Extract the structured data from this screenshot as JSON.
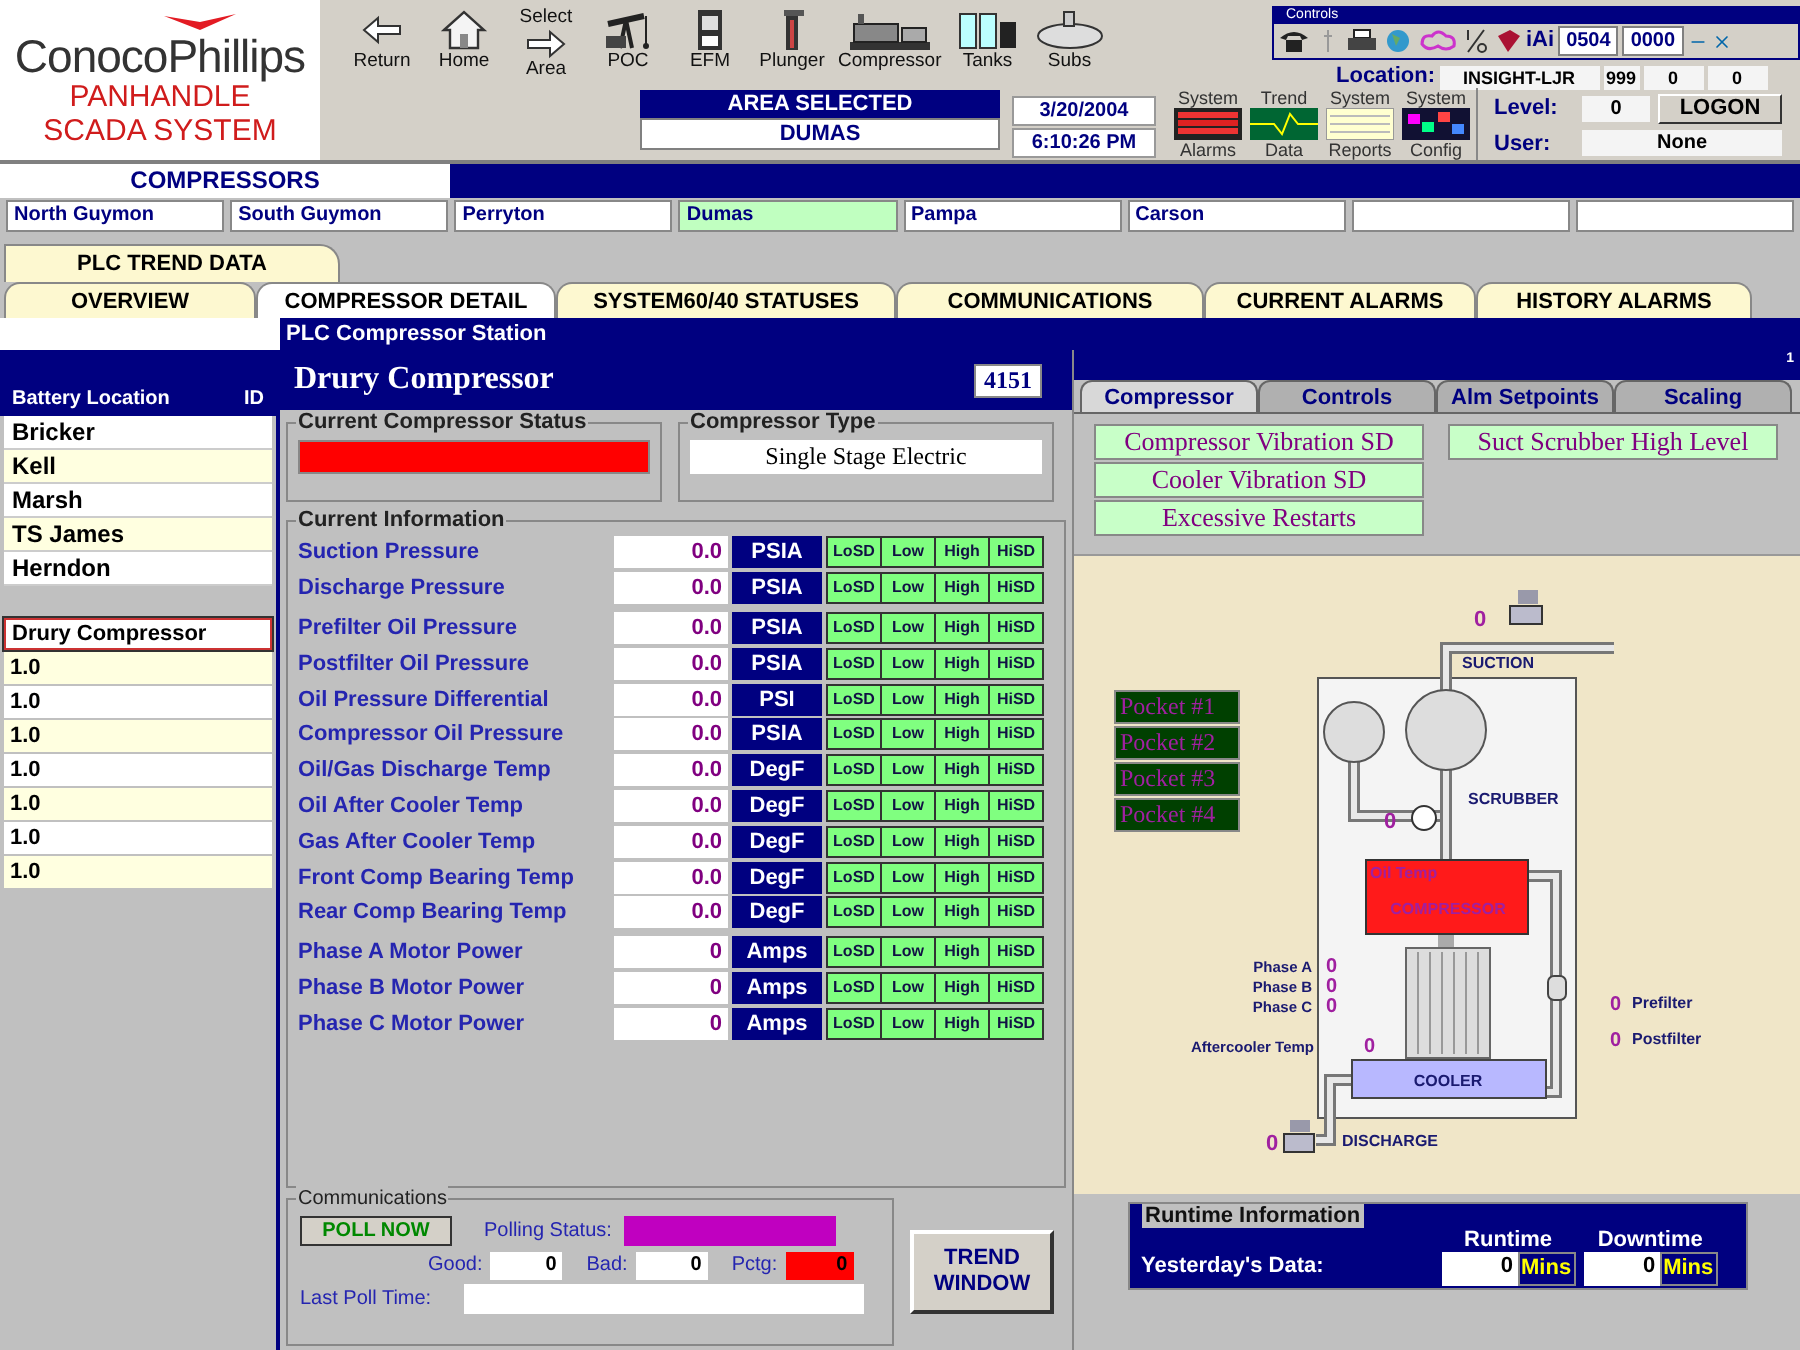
{
  "logo": {
    "company": "ConocoPhillips",
    "subtitle": [
      "PANHANDLE",
      "SCADA SYSTEM"
    ]
  },
  "toolbar": [
    {
      "kind": "return",
      "label": "Return"
    },
    {
      "kind": "home",
      "label": "Home"
    },
    {
      "kind": "select",
      "top_label": "Select",
      "label": "Area"
    },
    {
      "kind": "poc",
      "label": "POC"
    },
    {
      "kind": "efm",
      "label": "EFM"
    },
    {
      "kind": "plunger",
      "label": "Plunger"
    },
    {
      "kind": "compressor",
      "label": "Compressor"
    },
    {
      "kind": "tanks",
      "label": "Tanks"
    },
    {
      "kind": "subs",
      "label": "Subs"
    }
  ],
  "controls": {
    "title": "Controls",
    "brand": "iAi",
    "codes": [
      "0504",
      "0000"
    ]
  },
  "location": {
    "label": "Location:",
    "value": "INSIGHT-LJR",
    "fields": [
      "999",
      "0",
      "0"
    ]
  },
  "area": {
    "title": "AREA SELECTED",
    "value": "DUMAS"
  },
  "date": "3/20/2004",
  "time": "6:10:26 PM",
  "system_buttons": [
    {
      "kind": "alarms",
      "top": "System",
      "bottom": "Alarms"
    },
    {
      "kind": "trend",
      "top": "Trend",
      "bottom": "Data"
    },
    {
      "kind": "reports",
      "top": "System",
      "bottom": "Reports"
    },
    {
      "kind": "config",
      "top": "System",
      "bottom": "Config"
    }
  ],
  "level": {
    "label": "Level:",
    "value": "0"
  },
  "logon": "LOGON",
  "user": {
    "label": "User:",
    "value": "None"
  },
  "section_title": "COMPRESSORS",
  "areas": [
    {
      "label": "North Guymon",
      "selected": false
    },
    {
      "label": "South Guymon",
      "selected": false
    },
    {
      "label": "Perryton",
      "selected": false
    },
    {
      "label": "Dumas",
      "selected": true
    },
    {
      "label": "Pampa",
      "selected": false
    },
    {
      "label": "Carson",
      "selected": false
    }
  ],
  "tabs_top": [
    {
      "label": "PLC TREND DATA",
      "selected": false
    }
  ],
  "tabs": [
    {
      "label": "OVERVIEW",
      "selected": false
    },
    {
      "label": "COMPRESSOR DETAIL",
      "selected": true
    },
    {
      "label": "SYSTEM60/40 STATUSES",
      "selected": false
    },
    {
      "label": "COMMUNICATIONS",
      "selected": false
    },
    {
      "label": "CURRENT ALARMS",
      "selected": false
    },
    {
      "label": "HISTORY ALARMS",
      "selected": false
    }
  ],
  "station_title": "PLC Compressor Station",
  "battery_list": {
    "header": "Battery Location",
    "id_header": "ID",
    "items": [
      {
        "label": "Bricker",
        "selected": false
      },
      {
        "label": "Kell",
        "selected": false
      },
      {
        "label": "Marsh",
        "selected": false
      },
      {
        "label": "TS James",
        "selected": false
      },
      {
        "label": "Herndon",
        "selected": false
      }
    ]
  },
  "compressor_list": [
    {
      "label": "Drury Compressor",
      "selected": true
    },
    {
      "label": "1.0",
      "selected": false
    },
    {
      "label": "1.0",
      "selected": false
    },
    {
      "label": "1.0",
      "selected": false
    },
    {
      "label": "1.0",
      "selected": false
    },
    {
      "label": "1.0",
      "selected": false
    },
    {
      "label": "1.0",
      "selected": false
    },
    {
      "label": "1.0",
      "selected": false
    }
  ],
  "detail": {
    "title": "Drury Compressor",
    "id": "4151",
    "status_label": "Current Compressor Status",
    "type_label": "Compressor Type",
    "type": "Single Stage Electric",
    "info_label": "Current Information",
    "groups": [
      [
        {
          "label": "Suction Pressure",
          "value": "0.0",
          "unit": "PSIA",
          "alarms": [
            "LoSD",
            "Low",
            "High",
            "HiSD"
          ]
        },
        {
          "label": "Discharge Pressure",
          "value": "0.0",
          "unit": "PSIA",
          "alarms": [
            "LoSD",
            "Low",
            "High",
            "HiSD"
          ]
        }
      ],
      [
        {
          "label": "Prefilter Oil Pressure",
          "value": "0.0",
          "unit": "PSIA",
          "alarms": [
            "LoSD",
            "Low",
            "High",
            "HiSD"
          ]
        },
        {
          "label": "Postfilter Oil Pressure",
          "value": "0.0",
          "unit": "PSIA",
          "alarms": [
            "LoSD",
            "Low",
            "High",
            "HiSD"
          ]
        },
        {
          "label": "Oil Pressure Differential",
          "value": "0.0",
          "unit": "PSI",
          "alarms": [
            "LoSD",
            "Low",
            "High",
            "HiSD"
          ]
        },
        {
          "label": "Compressor Oil Pressure",
          "value": "0.0",
          "unit": "PSIA",
          "alarms": [
            "LoSD",
            "Low",
            "High",
            "HiSD"
          ]
        },
        {
          "label": "Oil/Gas Discharge Temp",
          "value": "0.0",
          "unit": "DegF",
          "alarms": [
            "LoSD",
            "Low",
            "High",
            "HiSD"
          ]
        },
        {
          "label": "Oil After Cooler Temp",
          "value": "0.0",
          "unit": "DegF",
          "alarms": [
            "LoSD",
            "Low",
            "High",
            "HiSD"
          ]
        },
        {
          "label": "Gas After Cooler Temp",
          "value": "0.0",
          "unit": "DegF",
          "alarms": [
            "LoSD",
            "Low",
            "High",
            "HiSD"
          ]
        },
        {
          "label": "Front Comp Bearing Temp",
          "value": "0.0",
          "unit": "DegF",
          "alarms": [
            "LoSD",
            "Low",
            "High",
            "HiSD"
          ]
        },
        {
          "label": "Rear Comp Bearing Temp",
          "value": "0.0",
          "unit": "DegF",
          "alarms": [
            "LoSD",
            "Low",
            "High",
            "HiSD"
          ]
        }
      ],
      [
        {
          "label": "Phase A Motor Power",
          "value": "0",
          "unit": "Amps",
          "alarms": [
            "LoSD",
            "Low",
            "High",
            "HiSD"
          ]
        },
        {
          "label": "Phase B Motor Power",
          "value": "0",
          "unit": "Amps",
          "alarms": [
            "LoSD",
            "Low",
            "High",
            "HiSD"
          ]
        },
        {
          "label": "Phase C Motor Power",
          "value": "0",
          "unit": "Amps",
          "alarms": [
            "LoSD",
            "Low",
            "High",
            "HiSD"
          ]
        }
      ]
    ]
  },
  "communications": {
    "title": "Communications",
    "poll_button": "POLL NOW",
    "polling_status_label": "Polling Status:",
    "good_label": "Good:",
    "good": "0",
    "bad_label": "Bad:",
    "bad": "0",
    "pctg_label": "Pctg:",
    "pctg": "0",
    "last_poll_label": "Last Poll Time:"
  },
  "trend_button": "TREND WINDOW",
  "page_number": "1",
  "right_tabs": [
    {
      "label": "Compressor",
      "selected": true
    },
    {
      "label": "Controls",
      "selected": false
    },
    {
      "label": "Alm Setpoints",
      "selected": false
    },
    {
      "label": "Scaling",
      "selected": false
    }
  ],
  "alarm_flags": {
    "left": [
      "Compressor Vibration SD",
      "Cooler Vibration SD",
      "Excessive Restarts"
    ],
    "right": [
      "Suct Scrubber High Level"
    ]
  },
  "pockets": [
    "Pocket #1",
    "Pocket #2",
    "Pocket #3",
    "Pocket #4"
  ],
  "diagram": {
    "suction_value": "0",
    "suction_label": "SUCTION",
    "scrubber_label": "SCRUBBER",
    "gauge_value": "0",
    "oil_temp_label": "Oil Temp",
    "compressor_label": "COMPRESSOR",
    "phases": [
      {
        "label": "Phase A",
        "value": "0"
      },
      {
        "label": "Phase B",
        "value": "0"
      },
      {
        "label": "Phase C",
        "value": "0"
      }
    ],
    "aftercooler_label": "Aftercooler Temp",
    "aftercooler_value": "0",
    "prefilter": {
      "label": "Prefilter",
      "value": "0"
    },
    "postfilter": {
      "label": "Postfilter",
      "value": "0"
    },
    "cooler_label": "COOLER",
    "discharge_label": "DISCHARGE",
    "discharge_value": "0"
  },
  "runtime": {
    "title": "Runtime Information",
    "runtime_header": "Runtime",
    "downtime_header": "Downtime",
    "row_label": "Yesterday's Data:",
    "runtime": "0",
    "runtime_unit": "Mins",
    "downtime": "0",
    "downtime_unit": "Mins"
  }
}
